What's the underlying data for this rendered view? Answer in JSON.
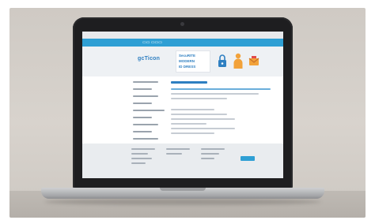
{
  "scene": {
    "description_icons": [
      "lock-icon",
      "person-icon",
      "mail-icon"
    ]
  },
  "website": {
    "logo_text": "gcTicon",
    "banner_lines": [
      "SecuRITE",
      "MODERN",
      "ID DRESS"
    ]
  },
  "colors": {
    "nav_blue": "#2e9fd4",
    "brand_blue": "#2e7fc1",
    "icon_orange": "#f2a23a"
  }
}
